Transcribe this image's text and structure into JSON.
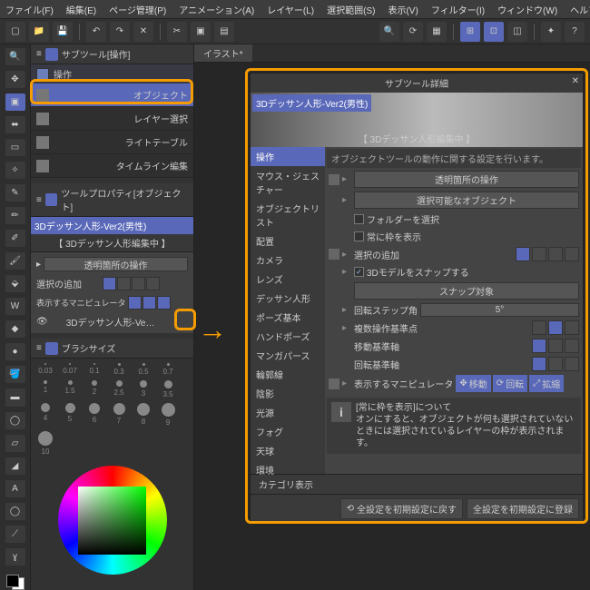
{
  "menu": [
    "ファイル(F)",
    "編集(E)",
    "ページ管理(P)",
    "アニメーション(A)",
    "レイヤー(L)",
    "選択範囲(S)",
    "表示(V)",
    "フィルター(I)",
    "ウィンドウ(W)",
    "ヘルプ(H)"
  ],
  "subtool": {
    "header": "サブツール[操作]",
    "group": "操作",
    "items": [
      "オブジェクト",
      "レイヤー選択",
      "ライトテーブル",
      "タイムライン編集"
    ]
  },
  "toolprop": {
    "header": "ツールプロパティ[オブジェクト]",
    "title": "3Dデッサン人形-Ver2(男性)",
    "sub": "【 3Dデッサン人形編集中 】",
    "rows": {
      "transparent": "透明箇所の操作",
      "add_select": "選択の追加",
      "manip": "表示するマニピュレータ",
      "layer": "3Dデッサン人形-Ve…"
    }
  },
  "brush": {
    "header": "ブラシサイズ",
    "sizes": [
      0.03,
      0.07,
      0.1,
      0.3,
      0.5,
      0.7,
      1,
      1.5,
      2,
      2.5,
      3,
      3.5,
      4,
      5,
      6,
      7,
      8,
      9,
      10
    ]
  },
  "tab": "イラスト*",
  "detail": {
    "title": "サブツール詳細",
    "banner_title": "3Dデッサン人形-Ver2(男性)",
    "banner_sub": "【 3Dデッサン人形編集中 】",
    "cats": [
      "操作",
      "マウス・ジェスチャー",
      "オブジェクトリスト",
      "配置",
      "カメラ",
      "レンズ",
      "デッサン人形",
      "ポーズ基本",
      "ハンドポーズ",
      "マンガパース",
      "輪郭線",
      "陰影",
      "光源",
      "フォグ",
      "天球",
      "環境"
    ],
    "desc": "オブジェクトツールの動作に関する設定を行います。",
    "rows": {
      "transparent": "透明箇所の操作",
      "selectable": "選択可能なオブジェクト",
      "sel_folder": "フォルダーを選択",
      "always_frame": "常に枠を表示",
      "add_select": "選択の追加",
      "snap_3d": "3Dモデルをスナップする",
      "snap_target": "スナップ対象",
      "rotate_step": "回転ステップ角",
      "rotate_step_val": "5°",
      "multi_origin": "複数操作基準点",
      "move_axis": "移動基準軸",
      "rotate_axis": "回転基準軸",
      "manip": "表示するマニピュレータ",
      "manip_move": "移動",
      "manip_rot": "回転",
      "manip_scale": "拡縮"
    },
    "info_title": "[常に枠を表示]について",
    "info_body": "オンにすると、オブジェクトが何も選択されていないときには選択されているレイヤーの枠が表示されます。",
    "cat_display": "カテゴリ表示",
    "footer_reset": "全設定を初期設定に戻す",
    "footer_register": "全設定を初期設定に登録"
  }
}
